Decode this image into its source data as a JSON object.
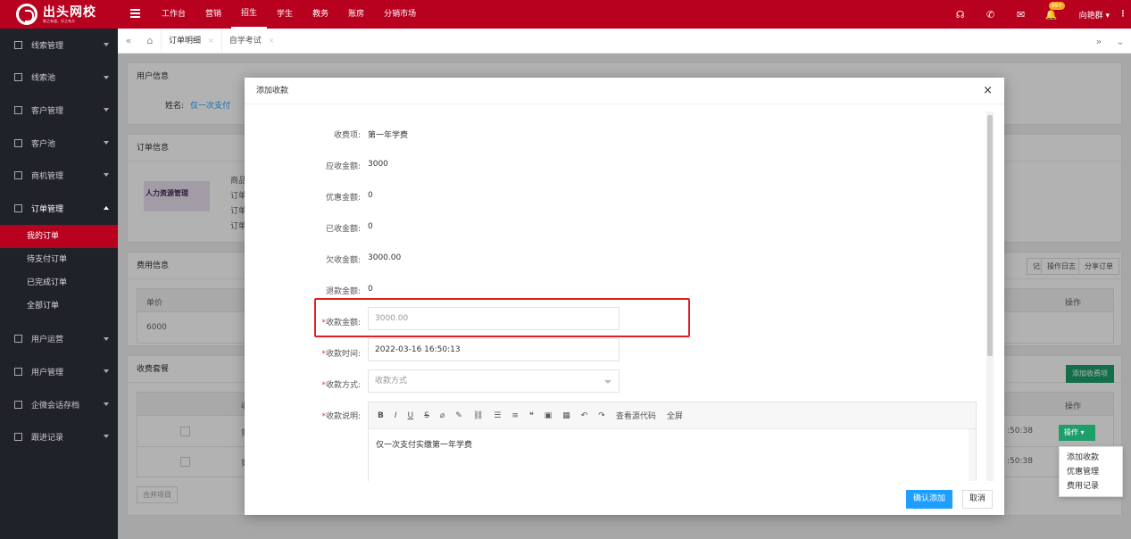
{
  "brand": {
    "title": "出头网校",
    "subtitle": "新之有道，学之有方"
  },
  "topnav": [
    "工作台",
    "营销",
    "招生",
    "学生",
    "教务",
    "账房",
    "分销市场"
  ],
  "topbar": {
    "badge": "99+",
    "user": "向艳群 ▾",
    "more": "⋮"
  },
  "sidebar": {
    "items": [
      {
        "label": "线索管理"
      },
      {
        "label": "线索池"
      },
      {
        "label": "客户管理"
      },
      {
        "label": "客户池"
      },
      {
        "label": "商机管理"
      },
      {
        "label": "订单管理"
      }
    ],
    "subitems": [
      "我的订单",
      "待支付订单",
      "已完成订单",
      "全部订单"
    ],
    "items_after": [
      {
        "label": "用户运营"
      },
      {
        "label": "用户管理"
      },
      {
        "label": "企微会话存档"
      },
      {
        "label": "跟进记录"
      }
    ]
  },
  "tabs": [
    {
      "label": "订单明细"
    },
    {
      "label": "自学考试"
    }
  ],
  "background": {
    "user_info": "用户信息",
    "name_label": "姓名:",
    "name_value": "仅一次支付",
    "order_info": "订单信息",
    "course_img_text": "人力资源管理",
    "order_lines": [
      "商品",
      "订单",
      "订单",
      "订单"
    ],
    "fee_info": "费用信息",
    "fee_buttons": [
      "记录",
      "操作日志",
      "分享订单"
    ],
    "unit_price_label": "单价",
    "unit_price_value": "6000",
    "op_label": "操作",
    "package": "收费套餐",
    "add_fee_button": "添加收费项",
    "col_fee": "收",
    "row_times": [
      ":50:38",
      ":50:38"
    ],
    "row_marks": [
      "第",
      "第"
    ],
    "op_button": "操作 ▾",
    "merge_button": "合并项目"
  },
  "dropdown": [
    "添加收款",
    "优惠管理",
    "费用记录"
  ],
  "modal": {
    "title": "添加收款",
    "close": "×",
    "fields": [
      {
        "label": "收费项:",
        "value": "第一年学费"
      },
      {
        "label": "应收金额:",
        "value": "3000"
      },
      {
        "label": "优惠金额:",
        "value": "0"
      },
      {
        "label": "已收金额:",
        "value": "0"
      },
      {
        "label": "欠收金额:",
        "value": "3000.00"
      },
      {
        "label": "退款金额:",
        "value": "0"
      }
    ],
    "amount_label": "收款金额:",
    "amount_placeholder": "3000.00",
    "time_label": "收款时间:",
    "time_value": "2022-03-16 16:50:13",
    "method_label": "收款方式:",
    "method_placeholder": "收款方式",
    "note_label": "收款说明:",
    "editor_tools": [
      "B",
      "I",
      "U",
      "S",
      "⌀",
      "✎",
      "⛓",
      "☰",
      "≡",
      "❝",
      "▣",
      "▦",
      "↶",
      "↷",
      "查看源代码",
      "全屏"
    ],
    "editor_text": "仅一次支付实缴第一年学费",
    "confirm": "确认添加",
    "cancel": "取消"
  }
}
